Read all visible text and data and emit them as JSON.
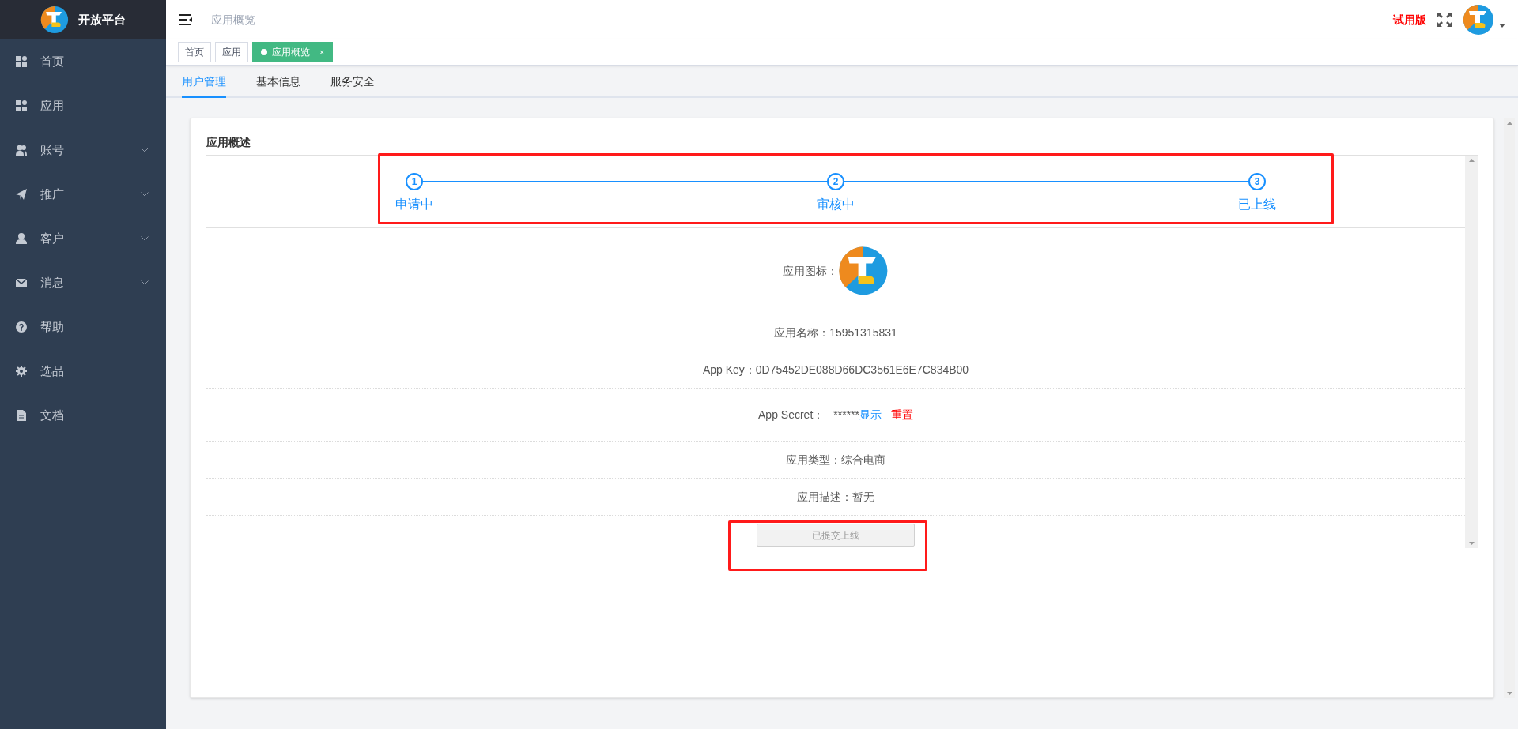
{
  "sidebar": {
    "brand": "开放平台",
    "items": [
      {
        "label": "首页",
        "expandable": false
      },
      {
        "label": "应用",
        "expandable": false
      },
      {
        "label": "账号",
        "expandable": true
      },
      {
        "label": "推广",
        "expandable": true
      },
      {
        "label": "客户",
        "expandable": true
      },
      {
        "label": "消息",
        "expandable": true
      },
      {
        "label": "帮助",
        "expandable": false
      },
      {
        "label": "选品",
        "expandable": false
      },
      {
        "label": "文档",
        "expandable": false
      }
    ]
  },
  "topbar": {
    "breadcrumb": "应用概览",
    "trial": "试用版"
  },
  "tag_tabs": [
    {
      "label": "首页",
      "selected": false
    },
    {
      "label": "应用",
      "selected": false
    },
    {
      "label": "应用概览",
      "selected": true,
      "close": "×"
    }
  ],
  "tabs": [
    {
      "label": "用户管理",
      "selected": true
    },
    {
      "label": "基本信息",
      "selected": false
    },
    {
      "label": "服务安全",
      "selected": false
    }
  ],
  "card": {
    "title": "应用概述",
    "steps": [
      {
        "number": "1",
        "label": "申请中"
      },
      {
        "number": "2",
        "label": "审核中"
      },
      {
        "number": "3",
        "label": "已上线"
      }
    ],
    "rows": [
      {
        "kind": "image",
        "label": "应用图标："
      },
      {
        "kind": "text",
        "label": "应用名称：",
        "value": "15951315831"
      },
      {
        "kind": "text",
        "label": "App Key：",
        "value": "0D75452DE088D66DC3561E6E7C834B00"
      },
      {
        "kind": "secret",
        "label": "App Secret：",
        "value": "******",
        "show_link": "显示",
        "reset_link": "重置"
      },
      {
        "kind": "text",
        "label": "应用类型：",
        "value": "综合电商"
      },
      {
        "kind": "text",
        "label": "应用描述：",
        "value": "暂无"
      }
    ],
    "submit_button": {
      "label": "已提交上线",
      "disabled": true
    }
  }
}
